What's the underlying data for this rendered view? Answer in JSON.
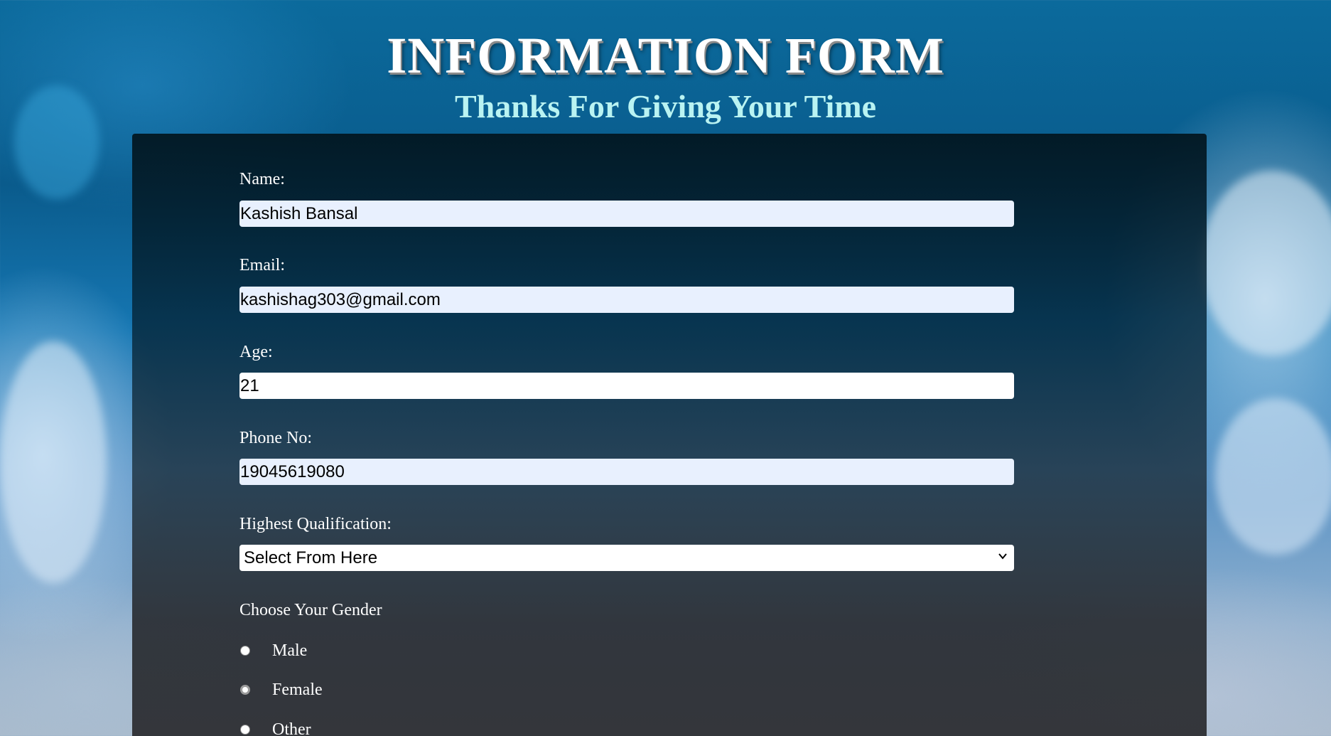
{
  "header": {
    "title": "INFORMATION FORM",
    "subtitle": "Thanks For Giving Your Time"
  },
  "form": {
    "name": {
      "label": "Name:",
      "value": "Kashish Bansal"
    },
    "email": {
      "label": "Email:",
      "value": "kashishag303@gmail.com"
    },
    "age": {
      "label": "Age:",
      "value": "21"
    },
    "phone": {
      "label": "Phone No:",
      "value": "19045619080"
    },
    "qualification": {
      "label": "Highest Qualification:",
      "selected": "Select From Here"
    },
    "gender": {
      "label": "Choose Your Gender",
      "options": [
        {
          "label": "Male",
          "checked": false
        },
        {
          "label": "Female",
          "checked": false
        },
        {
          "label": "Other",
          "checked": false
        }
      ]
    }
  },
  "colors": {
    "title": "#ffffff",
    "subtitle": "#b9f3f2",
    "autofill_input_bg": "#e8f0fe"
  }
}
